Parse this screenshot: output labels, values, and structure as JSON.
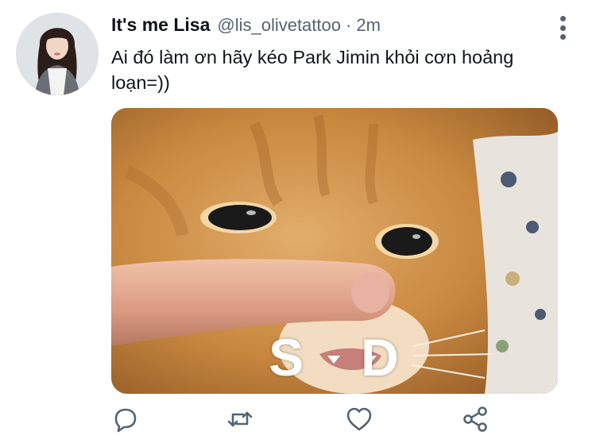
{
  "tweet": {
    "author": {
      "display_name": "It's me Lisa",
      "handle": "@lis_olivetattoo",
      "separator": "·",
      "time": "2m"
    },
    "text": "Ai đó làm ơn hãy kéo Park Jimin khỏi cơn hoảng loạn=))",
    "media": {
      "caption_left": "S",
      "caption_right": "D"
    },
    "actions": [
      "reply-icon",
      "retweet-icon",
      "like-icon",
      "share-icon"
    ],
    "more_icon": "more-vertical-icon"
  },
  "colors": {
    "text_primary": "#0f1419",
    "text_secondary": "#536471",
    "icon": "#536471",
    "background": "#ffffff"
  }
}
